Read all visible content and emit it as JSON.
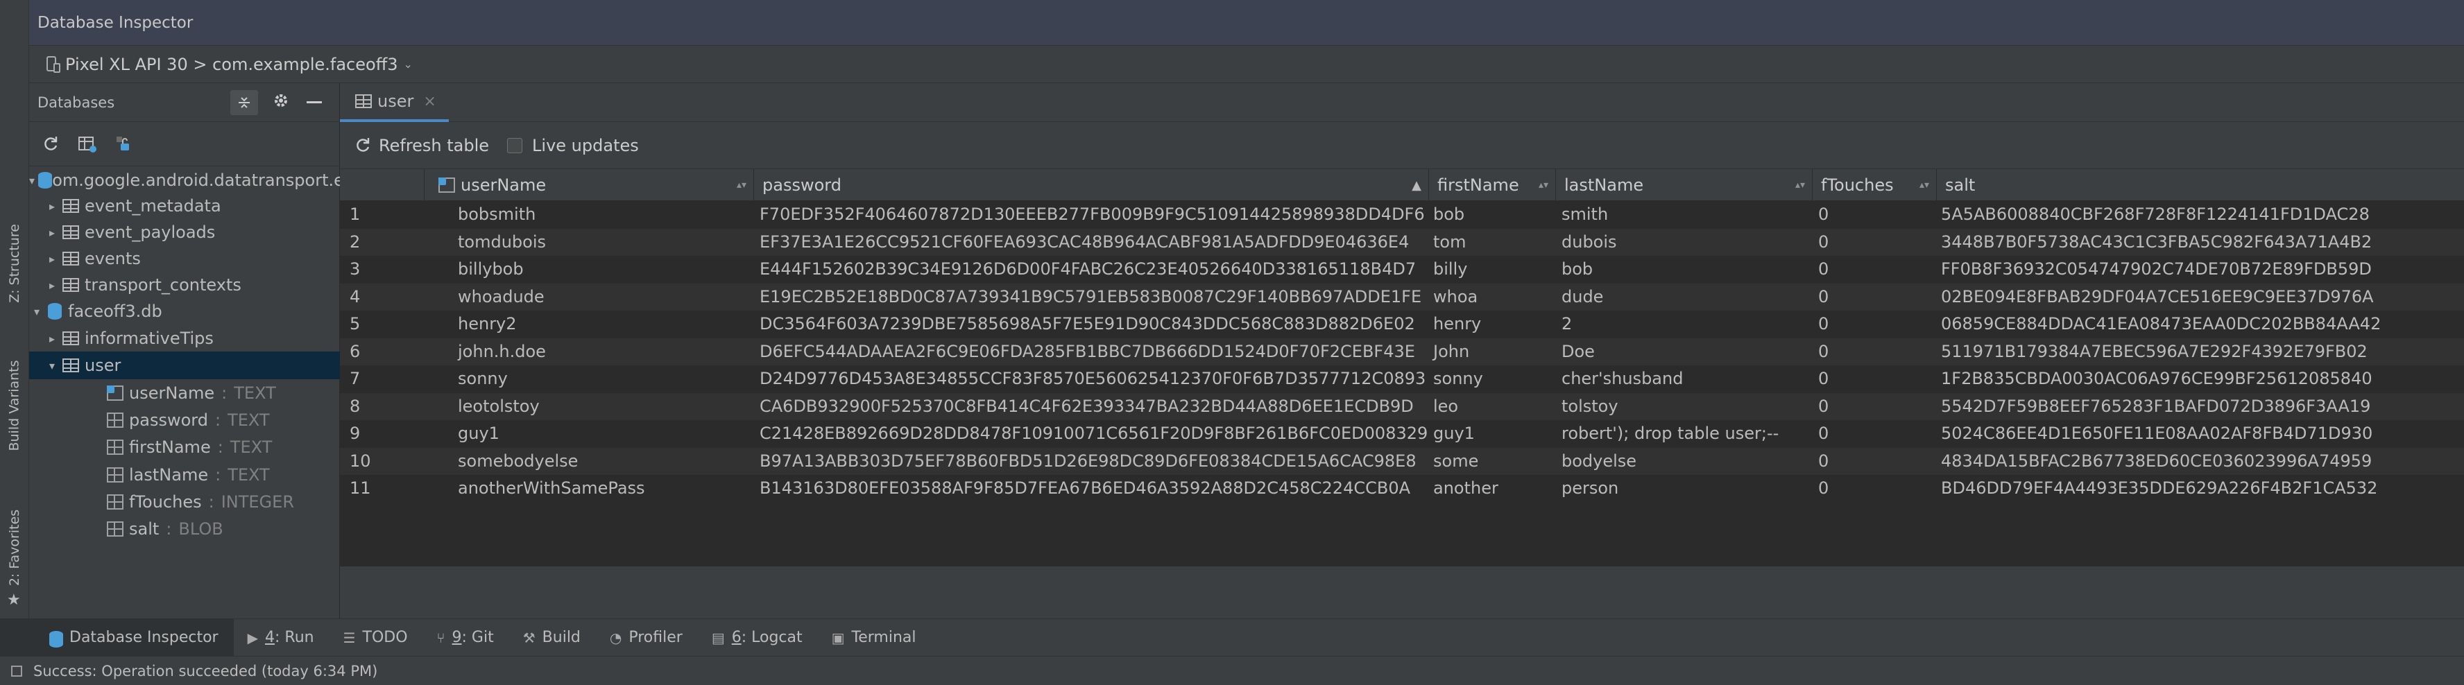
{
  "window": {
    "title": "Database Inspector"
  },
  "device_bar": {
    "label": "Pixel XL API 30 > com.example.faceoff3"
  },
  "left_stripe": {
    "structure": "Z: Structure",
    "build_variants": "Build Variants",
    "favorites": "2: Favorites"
  },
  "db_panel": {
    "header": "Databases",
    "tree": {
      "db1": "com.google.android.datatransport.events",
      "db1_tables": [
        "event_metadata",
        "event_payloads",
        "events",
        "transport_contexts"
      ],
      "db2": "faceoff3.db",
      "db2_tables": [
        "informativeTips",
        "user"
      ],
      "user_columns": [
        {
          "name": "userName",
          "type": "TEXT"
        },
        {
          "name": "password",
          "type": "TEXT"
        },
        {
          "name": "firstName",
          "type": "TEXT"
        },
        {
          "name": "lastName",
          "type": "TEXT"
        },
        {
          "name": "fTouches",
          "type": "INTEGER"
        },
        {
          "name": "salt",
          "type": "BLOB"
        }
      ],
      "type_separator": ":"
    }
  },
  "tabs": [
    {
      "label": "user",
      "close": "×"
    }
  ],
  "toolbar": {
    "refresh_label": "Refresh table",
    "live_updates_label": "Live updates"
  },
  "grid": {
    "columns": [
      "userName",
      "password",
      "firstName",
      "lastName",
      "fTouches",
      "salt"
    ],
    "rows": [
      [
        "1",
        "bobsmith",
        "F70EDF352F4064607872D130EEEB277FB009B9F9C510914425898938DD4DF6",
        "bob",
        "smith",
        "0",
        "5A5AB6008840CBF268F728F8F1224141FD1DAC28"
      ],
      [
        "2",
        "tomdubois",
        "EF37E3A1E26CC9521CF60FEA693CAC48B964ACABF981A5ADFDD9E04636E4",
        "tom",
        "dubois",
        "0",
        "3448B7B0F5738AC43C1C3FBA5C982F643A71A4B2"
      ],
      [
        "3",
        "billybob",
        "E444F152602B39C34E9126D6D00F4FABC26C23E40526640D338165118B4D7",
        "billy",
        "bob",
        "0",
        "FF0B8F36932C054747902C74DE70B72E89FDB59D"
      ],
      [
        "4",
        "whoadude",
        "E19EC2B52E18BD0C87A739341B9C5791EB583B0087C29F140BB697ADDE1FE",
        "whoa",
        "dude",
        "0",
        "02BE094E8FBAB29DF04A7CE516EE9C9EE37D976A"
      ],
      [
        "5",
        "henry2",
        "DC3564F603A7239DBE7585698A5F7E5E91D90C843DDC568C883D882D6E02",
        "henry",
        "2",
        "0",
        "06859CE884DDAC41EA08473EAA0DC202BB84AA42"
      ],
      [
        "6",
        "john.h.doe",
        "D6EFC544ADAAEA2F6C9E06FDA285FB1BBC7DB666DD1524D0F70F2CEBF43E",
        "John",
        "Doe",
        "0",
        "511971B179384A7EBEC596A7E292F4392E79FB02"
      ],
      [
        "7",
        "sonny",
        "D24D9776D453A8E34855CCF83F8570E560625412370F0F6B7D3577712C0893",
        "sonny",
        "cher'shusband",
        "0",
        "1F2B835CBDA0030AC06A976CE99BF25612085840"
      ],
      [
        "8",
        "leotolstoy",
        "CA6DB932900F525370C8FB414C4F62E393347BA232BD44A88D6EE1ECDB9D",
        "leo",
        "tolstoy",
        "0",
        "5542D7F59B8EEF765283F1BAFD072D3896F3AA19"
      ],
      [
        "9",
        "guy1",
        "C21428EB892669D28DD8478F10910071C6561F20D9F8BF261B6FC0ED008329",
        "guy1",
        "robert'); drop table user;--",
        "0",
        "5024C86EE4D1E650FE11E08AA02AF8FB4D71D930"
      ],
      [
        "10",
        "somebodyelse",
        "B97A13ABB303D75EF78B60FBD51D26E98DC89D6FE08384CDE15A6CAC98E8",
        "some",
        "bodyelse",
        "0",
        "4834DA15BFAC2B67738ED60CE036023996A74959"
      ],
      [
        "11",
        "anotherWithSamePass",
        "B143163D80EFE03588AF9F85D7FEA67B6ED46A3592A88D2C458C224CCB0A",
        "another",
        "person",
        "0",
        "BD46DD79EF4A4493E35DDE629A226F4B2F1CA532"
      ]
    ]
  },
  "bottom_tabs": [
    {
      "key": "",
      "label": "Database Inspector",
      "icon": "database-icon"
    },
    {
      "key": "4",
      "label": ": Run",
      "icon": "run-icon"
    },
    {
      "key": "",
      "label": "TODO",
      "icon": "todo-icon"
    },
    {
      "key": "9",
      "label": ": Git",
      "icon": "git-icon"
    },
    {
      "key": "",
      "label": "Build",
      "icon": "build-icon"
    },
    {
      "key": "",
      "label": "Profiler",
      "icon": "profiler-icon"
    },
    {
      "key": "6",
      "label": ": Logcat",
      "icon": "logcat-icon"
    },
    {
      "key": "",
      "label": "Terminal",
      "icon": "terminal-icon"
    }
  ],
  "status": {
    "message": "Success: Operation succeeded (today 6:34 PM)"
  },
  "colors": {
    "accent": "#4a88c7",
    "selection": "#0d293e",
    "db_icon": "#4a9fd8"
  }
}
